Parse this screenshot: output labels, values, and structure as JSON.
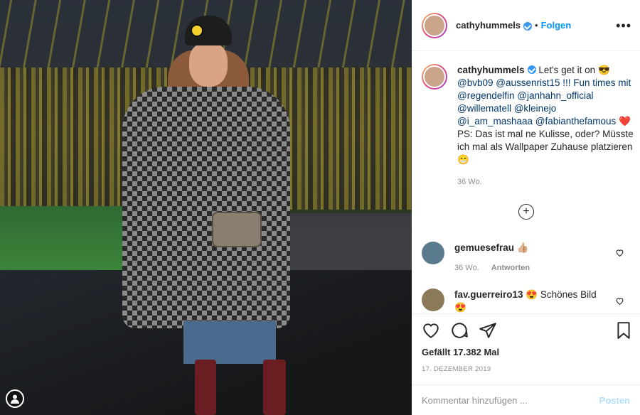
{
  "header": {
    "username": "cathyhummels",
    "separator": "•",
    "follow_label": "Folgen",
    "more_label": "•••"
  },
  "caption": {
    "username": "cathyhummels",
    "text_start": "Let's get it on 😎",
    "mentions_line": "@bvb09 @aussenrist15 !!! Fun times mit @regendelfin @janhahn_official @willematell @kleinejo @i_am_mashaaa @fabianthefamous",
    "text_end": "❤️ PS: Das ist mal ne Kulisse, oder? Müsste ich mal als Wallpaper Zuhause platzieren 😁",
    "time": "36 Wo."
  },
  "plus_label": "+",
  "comments": [
    {
      "username": "gemuesefrau",
      "text": "👍🏼",
      "time": "36 Wo.",
      "reply": "Antworten",
      "avatar_color": "#5a7a8e"
    },
    {
      "username": "fav.guerreiro13",
      "text": "😍 Schönes Bild",
      "extra": "😍",
      "avatar_color": "#8a7a5a"
    }
  ],
  "actions": {
    "likes": "Gefällt 17.382 Mal",
    "date": "17. DEZEMBER 2019"
  },
  "comment_box": {
    "placeholder": "Kommentar hinzufügen ...",
    "post_label": "Posten"
  },
  "colors": {
    "link": "#00376b",
    "follow": "#0095f6",
    "verified": "#3897f0"
  },
  "icons": [
    "heart-icon",
    "comment-icon",
    "share-icon",
    "bookmark-icon",
    "verified-icon",
    "user-icon",
    "more-icon",
    "heart-small-icon"
  ]
}
